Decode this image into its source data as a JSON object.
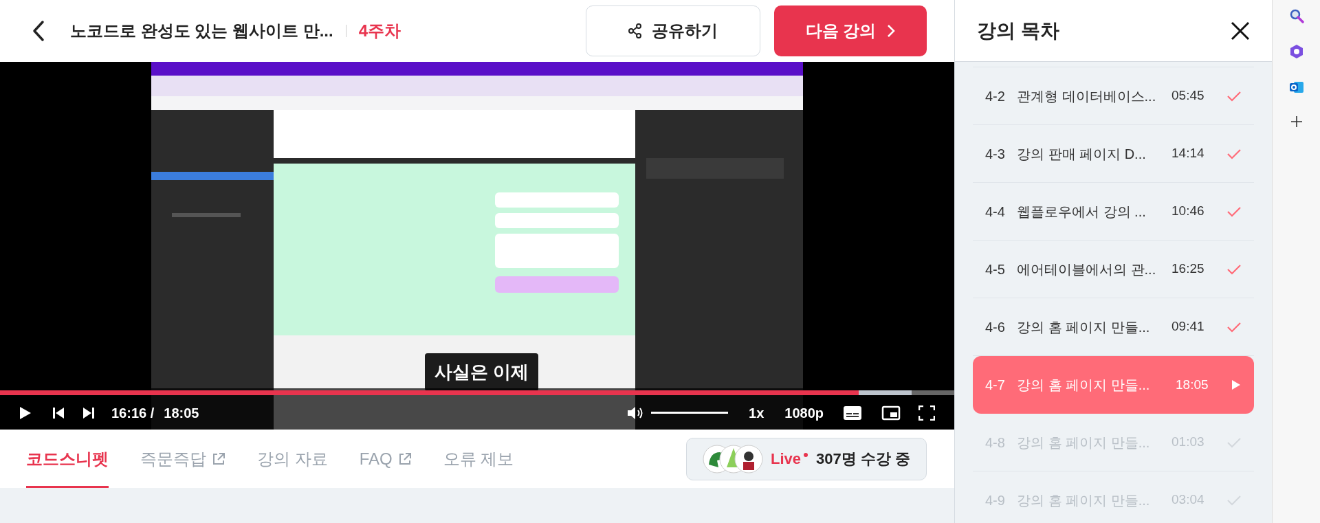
{
  "header": {
    "title": "노코드로 완성도 있는 웹사이트 만...",
    "week": "4주차",
    "share_button": "공유하기",
    "next_button": "다음 강의"
  },
  "player": {
    "subtitle": "사실은 이제",
    "progress": {
      "level": 0.9
    },
    "buffered": {
      "level": 0.955
    },
    "current_time": "16:16 /",
    "duration": "18:05",
    "volume": {
      "level": 1
    },
    "speed": "1x",
    "quality": "1080p"
  },
  "tabs": [
    {
      "label": "코드스니펫",
      "selected": true,
      "external": false
    },
    {
      "label": "즉문즉답",
      "selected": false,
      "external": true
    },
    {
      "label": "강의 자료",
      "selected": false,
      "external": false
    },
    {
      "label": "FAQ",
      "selected": false,
      "external": true
    },
    {
      "label": "오류 제보",
      "selected": false,
      "external": false
    }
  ],
  "live": {
    "label": "Live",
    "count": "307명 수강 중"
  },
  "sidebar": {
    "title": "강의 목차",
    "items": [
      {
        "number": "4-2",
        "title": "관계형 데이터베이스...",
        "time": "05:45",
        "watched": true,
        "selected": false
      },
      {
        "number": "4-3",
        "title": "강의 판매 페이지 D...",
        "time": "14:14",
        "watched": true,
        "selected": false
      },
      {
        "number": "4-4",
        "title": "웹플로우에서 강의 ...",
        "time": "10:46",
        "watched": true,
        "selected": false
      },
      {
        "number": "4-5",
        "title": "에어테이블에서의 관...",
        "time": "16:25",
        "watched": true,
        "selected": false
      },
      {
        "number": "4-6",
        "title": "강의 홈 페이지 만들...",
        "time": "09:41",
        "watched": true,
        "selected": false
      },
      {
        "number": "4-7",
        "title": "강의 홈 페이지 만들...",
        "time": "18:05",
        "selected": true
      },
      {
        "number": "4-8",
        "title": "강의 홈 페이지 만들...",
        "time": "01:03",
        "watched": false,
        "selected": false
      },
      {
        "number": "4-9",
        "title": "강의 홈 페이지 만들...",
        "time": "03:04",
        "watched": false,
        "selected": false
      }
    ]
  }
}
